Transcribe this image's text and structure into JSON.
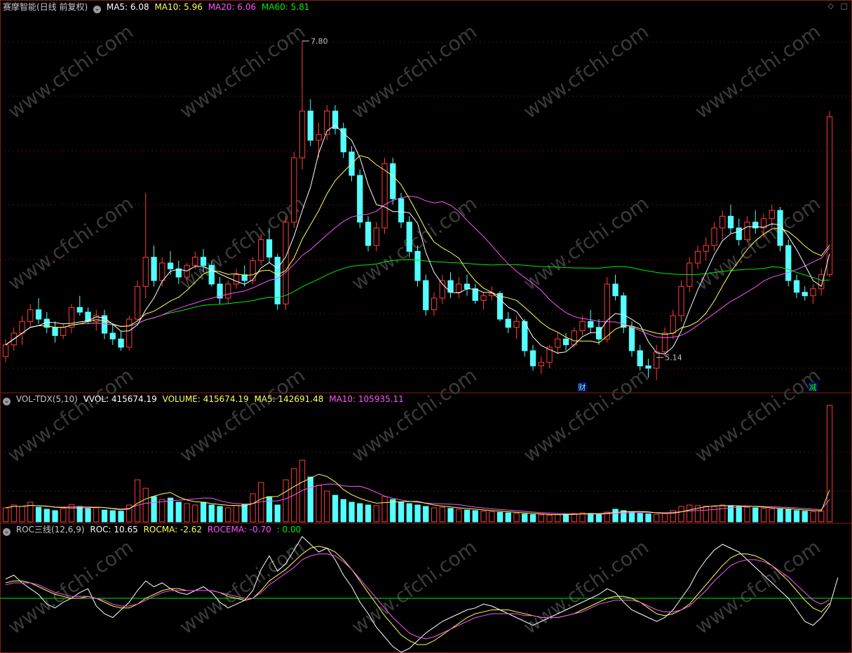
{
  "header": {
    "stock_name": "赛摩智能(日线 前复权)",
    "ma5_label": "MA5: 6.08",
    "ma10_label": "MA10: 5.96",
    "ma20_label": "MA20: 6.06",
    "ma60_label": "MA60: 5.81"
  },
  "volume_header": {
    "indicator": "VOL-TDX(5,10)",
    "vvol_label": "VVOL: 415674.19",
    "volume_label": "VOLUME: 415674.19",
    "ma5_label": "MA5: 142691.48",
    "ma10_label": "MA10: 105935.11"
  },
  "roc_header": {
    "indicator": "ROC三线(12,6,9)",
    "roc_label": "ROC: 10.65",
    "rocma_label": "ROCMA: -2.62",
    "rocema_label": "ROCEMA: -0.70",
    "zero_label": ": 0.00"
  },
  "annotations": {
    "high_label": "7.80",
    "low_label": "5.14",
    "marker_1": "财",
    "marker_2": "减"
  },
  "watermark": "www.cfchi.com",
  "colors": {
    "up": "#ff3b3b",
    "down": "#54ffff",
    "ma5": "#ffffff",
    "ma10": "#ffff54",
    "ma20": "#ff54ff",
    "ma60": "#00ee00",
    "frame": "#8b1a1a"
  },
  "chart_data": [
    {
      "type": "candlestick",
      "title": "赛摩智能(日线 前复权)",
      "ylim": [
        5.0,
        8.0
      ],
      "ohlc": [
        [
          5.1,
          5.25,
          5.05,
          5.2
        ],
        [
          5.2,
          5.35,
          5.15,
          5.3
        ],
        [
          5.3,
          5.45,
          5.2,
          5.4
        ],
        [
          5.4,
          5.55,
          5.35,
          5.5
        ],
        [
          5.5,
          5.6,
          5.38,
          5.42
        ],
        [
          5.42,
          5.48,
          5.3,
          5.35
        ],
        [
          5.35,
          5.4,
          5.22,
          5.28
        ],
        [
          5.28,
          5.38,
          5.25,
          5.35
        ],
        [
          5.35,
          5.55,
          5.3,
          5.52
        ],
        [
          5.52,
          5.62,
          5.45,
          5.48
        ],
        [
          5.48,
          5.52,
          5.38,
          5.4
        ],
        [
          5.4,
          5.5,
          5.32,
          5.45
        ],
        [
          5.45,
          5.5,
          5.25,
          5.3
        ],
        [
          5.3,
          5.38,
          5.2,
          5.25
        ],
        [
          5.25,
          5.32,
          5.15,
          5.18
        ],
        [
          5.18,
          5.45,
          5.15,
          5.42
        ],
        [
          5.42,
          5.75,
          5.4,
          5.7
        ],
        [
          5.7,
          6.5,
          5.6,
          5.95
        ],
        [
          5.95,
          6.05,
          5.7,
          5.75
        ],
        [
          5.75,
          5.95,
          5.7,
          5.9
        ],
        [
          5.9,
          6.0,
          5.8,
          5.85
        ],
        [
          5.85,
          5.92,
          5.72,
          5.78
        ],
        [
          5.78,
          5.9,
          5.75,
          5.88
        ],
        [
          5.88,
          6.0,
          5.85,
          5.95
        ],
        [
          5.95,
          6.02,
          5.82,
          5.88
        ],
        [
          5.88,
          5.92,
          5.7,
          5.72
        ],
        [
          5.72,
          5.78,
          5.55,
          5.6
        ],
        [
          5.6,
          5.75,
          5.55,
          5.72
        ],
        [
          5.72,
          5.85,
          5.68,
          5.8
        ],
        [
          5.8,
          5.88,
          5.7,
          5.75
        ],
        [
          5.75,
          5.95,
          5.72,
          5.92
        ],
        [
          5.92,
          6.15,
          5.88,
          6.1
        ],
        [
          6.1,
          6.2,
          5.9,
          5.95
        ],
        [
          5.95,
          5.98,
          5.5,
          5.55
        ],
        [
          5.55,
          6.3,
          5.5,
          6.25
        ],
        [
          6.25,
          6.85,
          6.2,
          6.8
        ],
        [
          6.8,
          7.8,
          6.7,
          7.2
        ],
        [
          7.2,
          7.3,
          6.9,
          6.95
        ],
        [
          6.95,
          7.1,
          6.8,
          7.0
        ],
        [
          7.0,
          7.25,
          6.95,
          7.2
        ],
        [
          7.2,
          7.25,
          7.0,
          7.05
        ],
        [
          7.05,
          7.1,
          6.8,
          6.85
        ],
        [
          6.85,
          6.9,
          6.6,
          6.65
        ],
        [
          6.65,
          6.7,
          6.2,
          6.25
        ],
        [
          6.25,
          6.3,
          6.0,
          6.05
        ],
        [
          6.05,
          6.25,
          6.0,
          6.2
        ],
        [
          6.2,
          6.8,
          6.15,
          6.75
        ],
        [
          6.75,
          6.8,
          6.4,
          6.45
        ],
        [
          6.45,
          6.5,
          6.2,
          6.25
        ],
        [
          6.25,
          6.3,
          5.95,
          6.0
        ],
        [
          6.0,
          6.05,
          5.7,
          5.75
        ],
        [
          5.75,
          5.8,
          5.45,
          5.5
        ],
        [
          5.5,
          5.65,
          5.45,
          5.6
        ],
        [
          5.6,
          5.8,
          5.55,
          5.75
        ],
        [
          5.75,
          5.82,
          5.6,
          5.65
        ],
        [
          5.65,
          5.78,
          5.6,
          5.72
        ],
        [
          5.72,
          5.8,
          5.62,
          5.68
        ],
        [
          5.68,
          5.72,
          5.55,
          5.58
        ],
        [
          5.58,
          5.65,
          5.5,
          5.62
        ],
        [
          5.62,
          5.7,
          5.58,
          5.64
        ],
        [
          5.64,
          5.66,
          5.4,
          5.42
        ],
        [
          5.42,
          5.48,
          5.3,
          5.35
        ],
        [
          5.35,
          5.45,
          5.25,
          5.4
        ],
        [
          5.4,
          5.42,
          5.1,
          5.15
        ],
        [
          5.15,
          5.2,
          4.98,
          5.02
        ],
        [
          5.02,
          5.1,
          4.95,
          5.05
        ],
        [
          5.05,
          5.2,
          5.0,
          5.18
        ],
        [
          5.18,
          5.3,
          5.12,
          5.25
        ],
        [
          5.25,
          5.3,
          5.15,
          5.2
        ],
        [
          5.2,
          5.35,
          5.18,
          5.32
        ],
        [
          5.32,
          5.45,
          5.28,
          5.4
        ],
        [
          5.4,
          5.5,
          5.3,
          5.35
        ],
        [
          5.35,
          5.42,
          5.2,
          5.25
        ],
        [
          5.25,
          5.78,
          5.22,
          5.72
        ],
        [
          5.72,
          5.8,
          5.58,
          5.62
        ],
        [
          5.62,
          5.65,
          5.3,
          5.35
        ],
        [
          5.35,
          5.4,
          5.1,
          5.15
        ],
        [
          5.15,
          5.2,
          4.98,
          5.02
        ],
        [
          5.02,
          5.08,
          4.92,
          5.0
        ],
        [
          5.0,
          5.2,
          4.9,
          5.14
        ],
        [
          5.14,
          5.35,
          5.1,
          5.3
        ],
        [
          5.3,
          5.5,
          5.25,
          5.45
        ],
        [
          5.45,
          5.75,
          5.4,
          5.7
        ],
        [
          5.7,
          5.95,
          5.65,
          5.9
        ],
        [
          5.9,
          6.05,
          5.85,
          6.0
        ],
        [
          6.0,
          6.12,
          5.92,
          6.05
        ],
        [
          6.05,
          6.25,
          6.0,
          6.2
        ],
        [
          6.2,
          6.35,
          6.1,
          6.3
        ],
        [
          6.3,
          6.4,
          6.15,
          6.2
        ],
        [
          6.2,
          6.28,
          6.05,
          6.1
        ],
        [
          6.1,
          6.3,
          6.08,
          6.25
        ],
        [
          6.25,
          6.35,
          6.15,
          6.2
        ],
        [
          6.2,
          6.32,
          6.12,
          6.28
        ],
        [
          6.28,
          6.4,
          6.2,
          6.35
        ],
        [
          6.35,
          6.38,
          6.0,
          6.05
        ],
        [
          6.05,
          6.1,
          5.7,
          5.75
        ],
        [
          5.75,
          5.8,
          5.6,
          5.65
        ],
        [
          5.65,
          5.7,
          5.58,
          5.62
        ],
        [
          5.62,
          5.72,
          5.55,
          5.68
        ],
        [
          5.68,
          5.85,
          5.62,
          5.8
        ],
        [
          5.8,
          7.2,
          5.78,
          7.15
        ]
      ],
      "high_marker": 7.8,
      "low_marker": 5.14
    },
    {
      "type": "bar",
      "title": "VOL-TDX(5,10)",
      "values": [
        50000,
        60000,
        55000,
        70000,
        52000,
        45000,
        40000,
        48000,
        62000,
        55000,
        47000,
        50000,
        42000,
        40000,
        38000,
        60000,
        150000,
        120000,
        90000,
        80000,
        85000,
        70000,
        65000,
        60000,
        70000,
        60000,
        55000,
        50000,
        58000,
        62000,
        100000,
        140000,
        90000,
        60000,
        150000,
        190000,
        220000,
        160000,
        130000,
        110000,
        95000,
        80000,
        70000,
        65000,
        60000,
        58000,
        90000,
        80000,
        70000,
        65000,
        60000,
        55000,
        50000,
        52000,
        48000,
        45000,
        42000,
        40000,
        38000,
        36000,
        34000,
        32000,
        30000,
        28000,
        26000,
        25000,
        24000,
        26000,
        28000,
        30000,
        32000,
        30000,
        28000,
        35000,
        45000,
        40000,
        35000,
        30000,
        28000,
        26000,
        30000,
        40000,
        55000,
        60000,
        58000,
        56000,
        55000,
        60000,
        58000,
        55000,
        52000,
        50000,
        48000,
        46000,
        45000,
        44000,
        40000,
        38000,
        36000,
        38000,
        415674
      ],
      "ma5_label": 142691.48,
      "ma10_label": 105935.11
    },
    {
      "type": "line",
      "title": "ROC三线(12,6,9)",
      "series": [
        {
          "name": "ROC",
          "values": [
            10,
            12,
            8,
            5,
            2,
            -3,
            -5,
            -2,
            0,
            3,
            5,
            -4,
            -8,
            -10,
            -6,
            -2,
            4,
            9,
            6,
            8,
            5,
            3,
            2,
            4,
            6,
            3,
            -2,
            -5,
            -3,
            -1,
            4,
            15,
            22,
            14,
            18,
            25,
            32,
            28,
            24,
            26,
            20,
            12,
            6,
            -2,
            -8,
            -15,
            -20,
            -25,
            -28,
            -26,
            -22,
            -18,
            -15,
            -12,
            -10,
            -8,
            -6,
            -5,
            -3,
            -4,
            -6,
            -8,
            -10,
            -12,
            -14,
            -12,
            -10,
            -8,
            -6,
            -4,
            -2,
            0,
            2,
            5,
            3,
            -2,
            -6,
            -8,
            -10,
            -12,
            -10,
            -6,
            0,
            6,
            14,
            20,
            25,
            28,
            26,
            24,
            20,
            16,
            12,
            8,
            4,
            0,
            -6,
            -12,
            -14,
            -10,
            -4,
            10.65
          ]
        },
        {
          "name": "ROCMA",
          "values": [
            8,
            9,
            9,
            8,
            6,
            4,
            2,
            1,
            0,
            0,
            1,
            0,
            -2,
            -4,
            -5,
            -5,
            -3,
            0,
            2,
            4,
            5,
            5,
            4,
            4,
            4,
            4,
            3,
            1,
            0,
            -1,
            0,
            4,
            9,
            12,
            15,
            19,
            23,
            26,
            27,
            26,
            24,
            20,
            15,
            9,
            3,
            -3,
            -9,
            -14,
            -19,
            -22,
            -24,
            -24,
            -22,
            -19,
            -16,
            -13,
            -10,
            -8,
            -7,
            -6,
            -6,
            -6,
            -7,
            -8,
            -9,
            -10,
            -10,
            -10,
            -9,
            -8,
            -6,
            -4,
            -2,
            0,
            1,
            1,
            0,
            -2,
            -5,
            -8,
            -9,
            -8,
            -6,
            -3,
            2,
            7,
            12,
            17,
            21,
            23,
            23,
            22,
            20,
            17,
            13,
            9,
            4,
            -1,
            -5,
            -7,
            -2.62
          ]
        },
        {
          "name": "ROCEMA",
          "values": [
            7,
            8,
            8,
            8,
            7,
            5,
            3,
            2,
            1,
            1,
            1,
            0,
            -1,
            -3,
            -4,
            -4,
            -3,
            -1,
            1,
            3,
            4,
            4,
            4,
            4,
            4,
            4,
            3,
            2,
            1,
            0,
            0,
            3,
            7,
            10,
            13,
            16,
            20,
            22,
            23,
            23,
            22,
            19,
            15,
            10,
            5,
            0,
            -5,
            -10,
            -14,
            -18,
            -20,
            -21,
            -20,
            -18,
            -16,
            -14,
            -12,
            -10,
            -9,
            -8,
            -8,
            -8,
            -8,
            -9,
            -9,
            -10,
            -10,
            -10,
            -9,
            -8,
            -7,
            -5,
            -3,
            -2,
            -1,
            -1,
            -1,
            -2,
            -4,
            -6,
            -7,
            -7,
            -6,
            -4,
            0,
            4,
            9,
            13,
            17,
            19,
            20,
            20,
            19,
            17,
            14,
            11,
            7,
            3,
            -1,
            -3,
            -0.7
          ]
        }
      ],
      "zero_line": 0.0
    }
  ]
}
